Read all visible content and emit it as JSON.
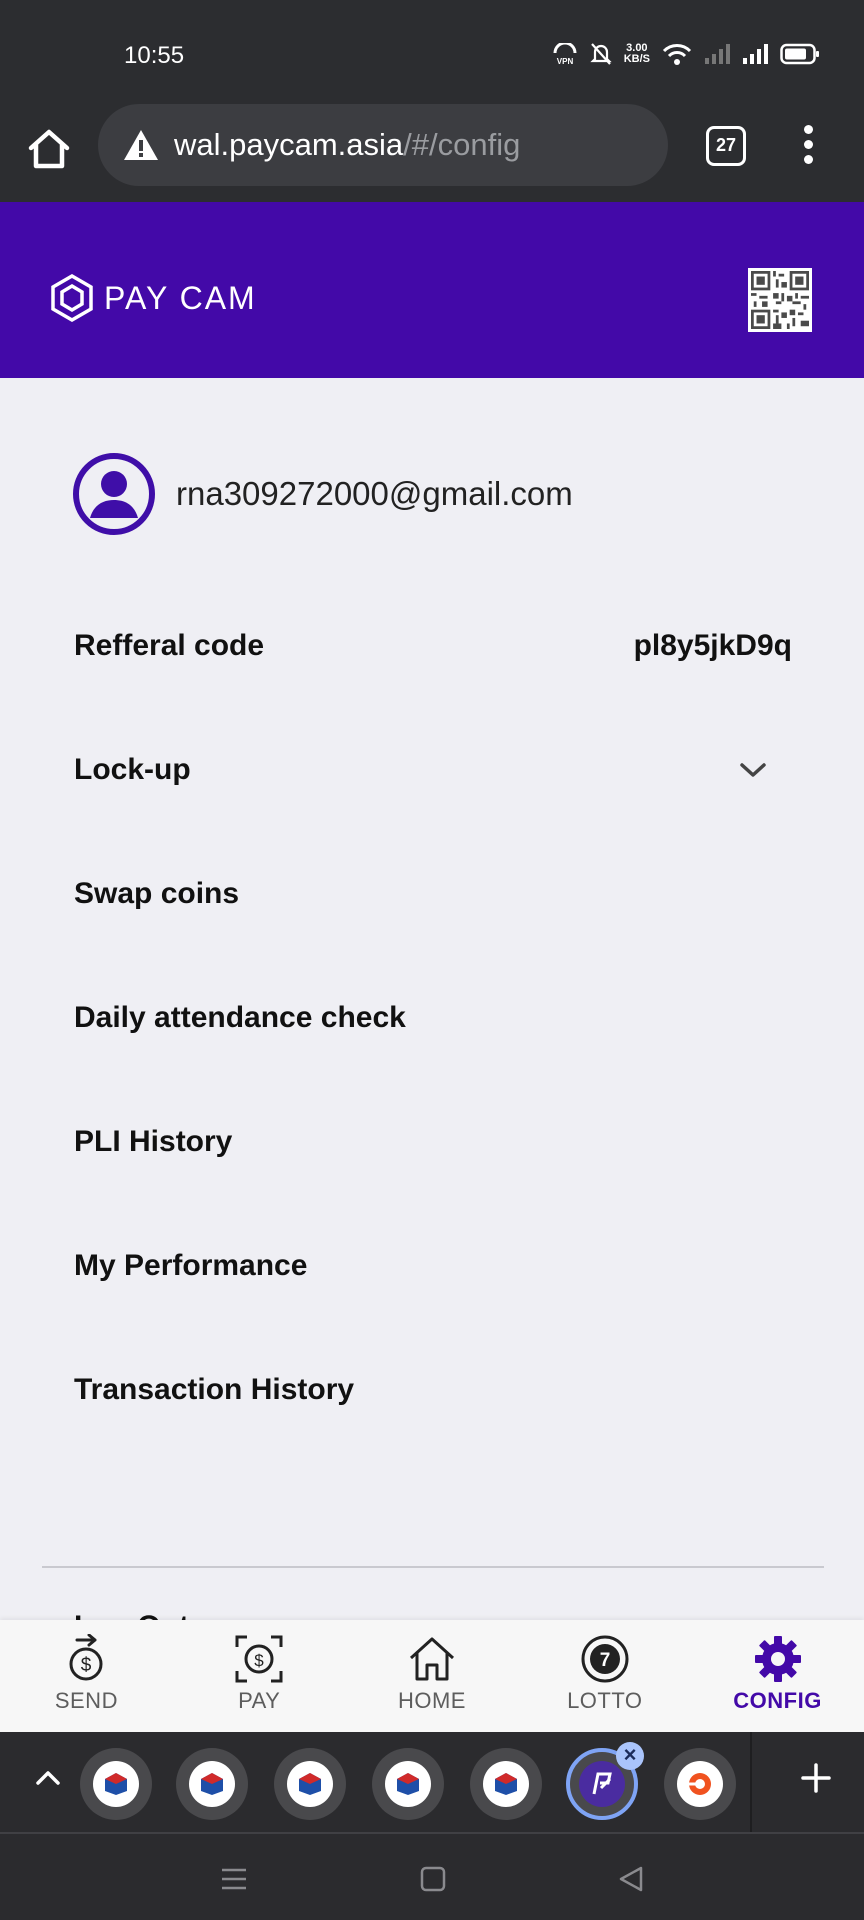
{
  "status_bar": {
    "time": "10:55",
    "net_speed_value": "3.00",
    "net_speed_unit": "KB/S"
  },
  "browser": {
    "url_host": "wal.paycam.asia",
    "url_path": "/#/config",
    "tab_count": "27"
  },
  "header": {
    "logo_text": "PAY CAM",
    "brand_color": "#4309a8"
  },
  "profile": {
    "email": "rna309272000@gmail.com"
  },
  "menu": {
    "referral": {
      "label": "Refferal code",
      "value": "pl8y5jkD9q"
    },
    "lockup": {
      "label": "Lock-up"
    },
    "swap": {
      "label": "Swap coins"
    },
    "attendance": {
      "label": "Daily attendance check"
    },
    "pli_history": {
      "label": "PLI History"
    },
    "performance": {
      "label": "My Performance"
    },
    "transactions": {
      "label": "Transaction History"
    },
    "peek": "Log Out"
  },
  "bottom_nav": {
    "send": "SEND",
    "pay": "PAY",
    "home": "HOME",
    "lotto": "LOTTO",
    "config": "CONFIG",
    "lotto_number": "7"
  }
}
